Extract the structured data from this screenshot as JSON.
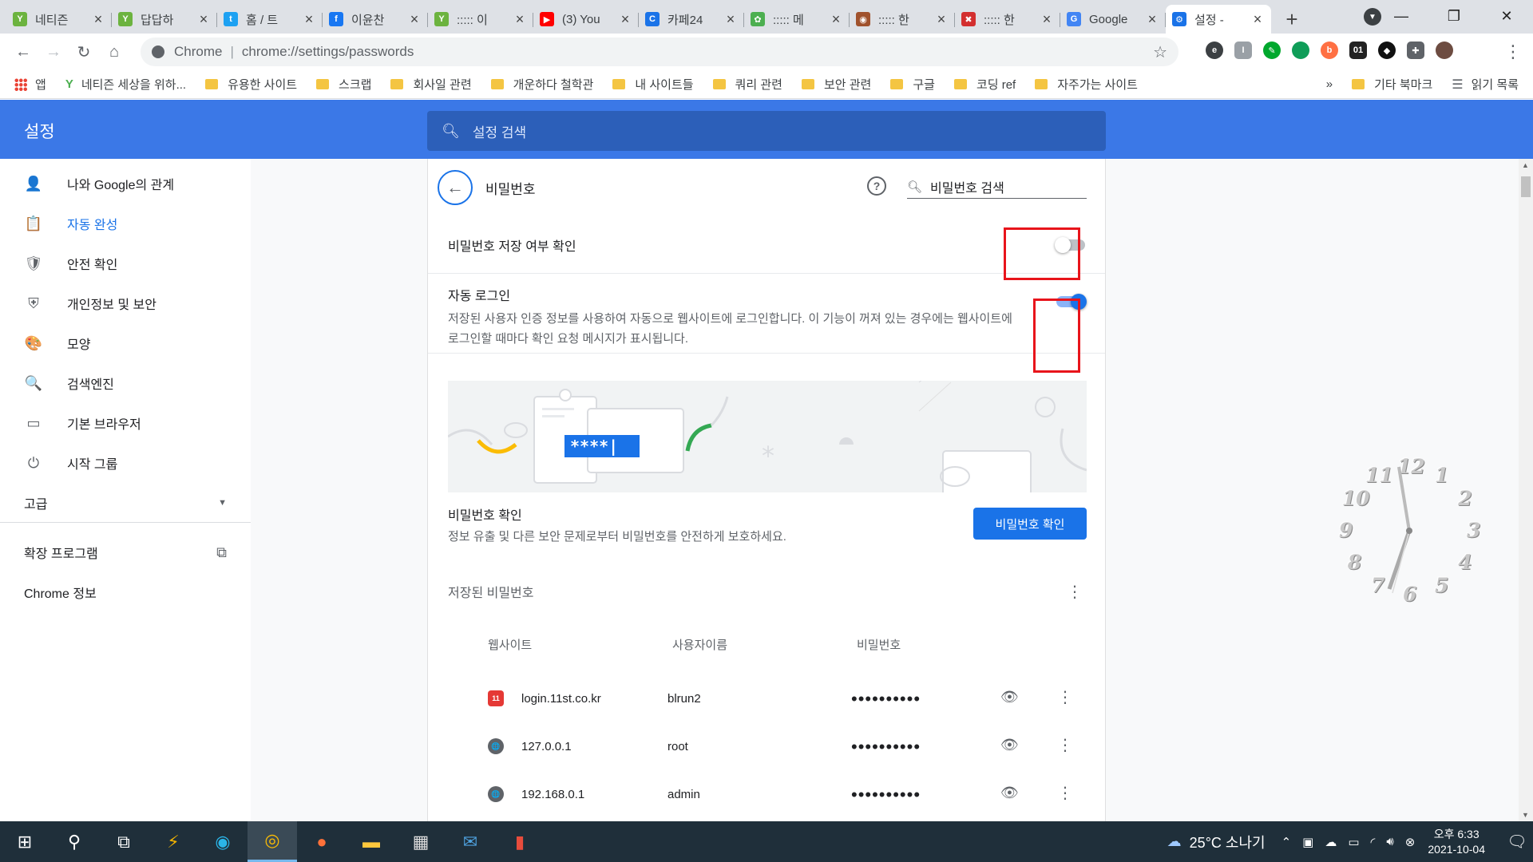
{
  "tabs": [
    {
      "label": "네티즌",
      "fav_color": "#6cb33f",
      "fav_glyph": "Y"
    },
    {
      "label": "답답하",
      "fav_color": "#6cb33f",
      "fav_glyph": "Y"
    },
    {
      "label": "홈 / 트",
      "fav_color": "#1da1f2",
      "fav_glyph": "t"
    },
    {
      "label": "이윤찬",
      "fav_color": "#1877f2",
      "fav_glyph": "f"
    },
    {
      "label": "::::: 이",
      "fav_color": "#6cb33f",
      "fav_glyph": "Y"
    },
    {
      "label": "(3) You",
      "fav_color": "#ff0000",
      "fav_glyph": "▶"
    },
    {
      "label": "카페24",
      "fav_color": "#1a73e8",
      "fav_glyph": "C"
    },
    {
      "label": "::::: 메",
      "fav_color": "#4caf50",
      "fav_glyph": "✿"
    },
    {
      "label": "::::: 한",
      "fav_color": "#a0522d",
      "fav_glyph": "◉"
    },
    {
      "label": "::::: 한",
      "fav_color": "#d32f2f",
      "fav_glyph": "✖"
    },
    {
      "label": "Google",
      "fav_color": "#4285f4",
      "fav_glyph": "G"
    },
    {
      "label": "설정 -",
      "fav_color": "#1a73e8",
      "fav_glyph": "⚙",
      "active": true
    }
  ],
  "newtab_glyph": "+",
  "omnibox": {
    "scheme": "Chrome",
    "url": "chrome://settings/passwords"
  },
  "bookmarks": {
    "apps": "앱",
    "items": [
      "네티즌 세상을 위하...",
      "유용한 사이트",
      "스크랩",
      "회사일 관련",
      "개운하다 철학관",
      "내 사이트들",
      "쿼리 관련",
      "보안 관련",
      "구글",
      "코딩 ref",
      "자주가는 사이트"
    ],
    "overflow": "»",
    "other": "기타 북마크",
    "reading_list": "읽기 목록"
  },
  "settings": {
    "title": "설정",
    "search_placeholder": "설정 검색"
  },
  "sidebar": {
    "items": [
      {
        "label": "나와 Google의 관계",
        "icon": "person-icon",
        "glyph": "👤"
      },
      {
        "label": "자동 완성",
        "icon": "clipboard-icon",
        "glyph": "📋",
        "active": true
      },
      {
        "label": "안전 확인",
        "icon": "shield-check-icon",
        "glyph": "🛡"
      },
      {
        "label": "개인정보 및 보안",
        "icon": "shield-half-icon",
        "glyph": "⛨"
      },
      {
        "label": "모양",
        "icon": "palette-icon",
        "glyph": "🎨"
      },
      {
        "label": "검색엔진",
        "icon": "search-icon",
        "glyph": "🔍"
      },
      {
        "label": "기본 브라우저",
        "icon": "browser-icon",
        "glyph": "▭"
      },
      {
        "label": "시작 그룹",
        "icon": "power-icon",
        "glyph": "⏻"
      }
    ],
    "advanced": "고급",
    "extensions": "확장 프로그램",
    "about": "Chrome 정보"
  },
  "passwords": {
    "title": "비밀번호",
    "search_placeholder": "비밀번호 검색",
    "offer_to_save": "비밀번호 저장 여부 확인",
    "offer_to_save_on": false,
    "auto_signin_title": "자동 로그인",
    "auto_signin_desc": "저장된 사용자 인증 정보를 사용하여 자동으로 웹사이트에 로그인합니다. 이 기능이 꺼져 있는 경우에는 웹사이트에 로그인할 때마다 확인 요청 메시지가 표시됩니다.",
    "auto_signin_on": true,
    "illustration_text": "****|",
    "check_title": "비밀번호 확인",
    "check_desc": "정보 유출 및 다른 보안 문제로부터 비밀번호를 안전하게 보호하세요.",
    "check_button": "비밀번호 확인",
    "saved_title": "저장된 비밀번호",
    "columns": {
      "site": "웹사이트",
      "user": "사용자이름",
      "pass": "비밀번호"
    },
    "rows": [
      {
        "site": "login.11st.co.kr",
        "user": "blrun2",
        "pass": "••••••••••",
        "icon_color": "#e53935",
        "icon_glyph": "11"
      },
      {
        "site": "127.0.0.1",
        "user": "root",
        "pass": "••••••••••",
        "icon_color": "#5f6368",
        "icon_glyph": "🌐"
      },
      {
        "site": "192.168.0.1",
        "user": "admin",
        "pass": "••••••••••",
        "icon_color": "#5f6368",
        "icon_glyph": "🌐"
      }
    ]
  },
  "clock_numbers": [
    "12",
    "1",
    "2",
    "3",
    "4",
    "5",
    "6",
    "7",
    "8",
    "9",
    "10",
    "11"
  ],
  "taskbar": {
    "weather": "25°C 소나기",
    "time": "오후 6:33",
    "date": "2021-10-04"
  }
}
